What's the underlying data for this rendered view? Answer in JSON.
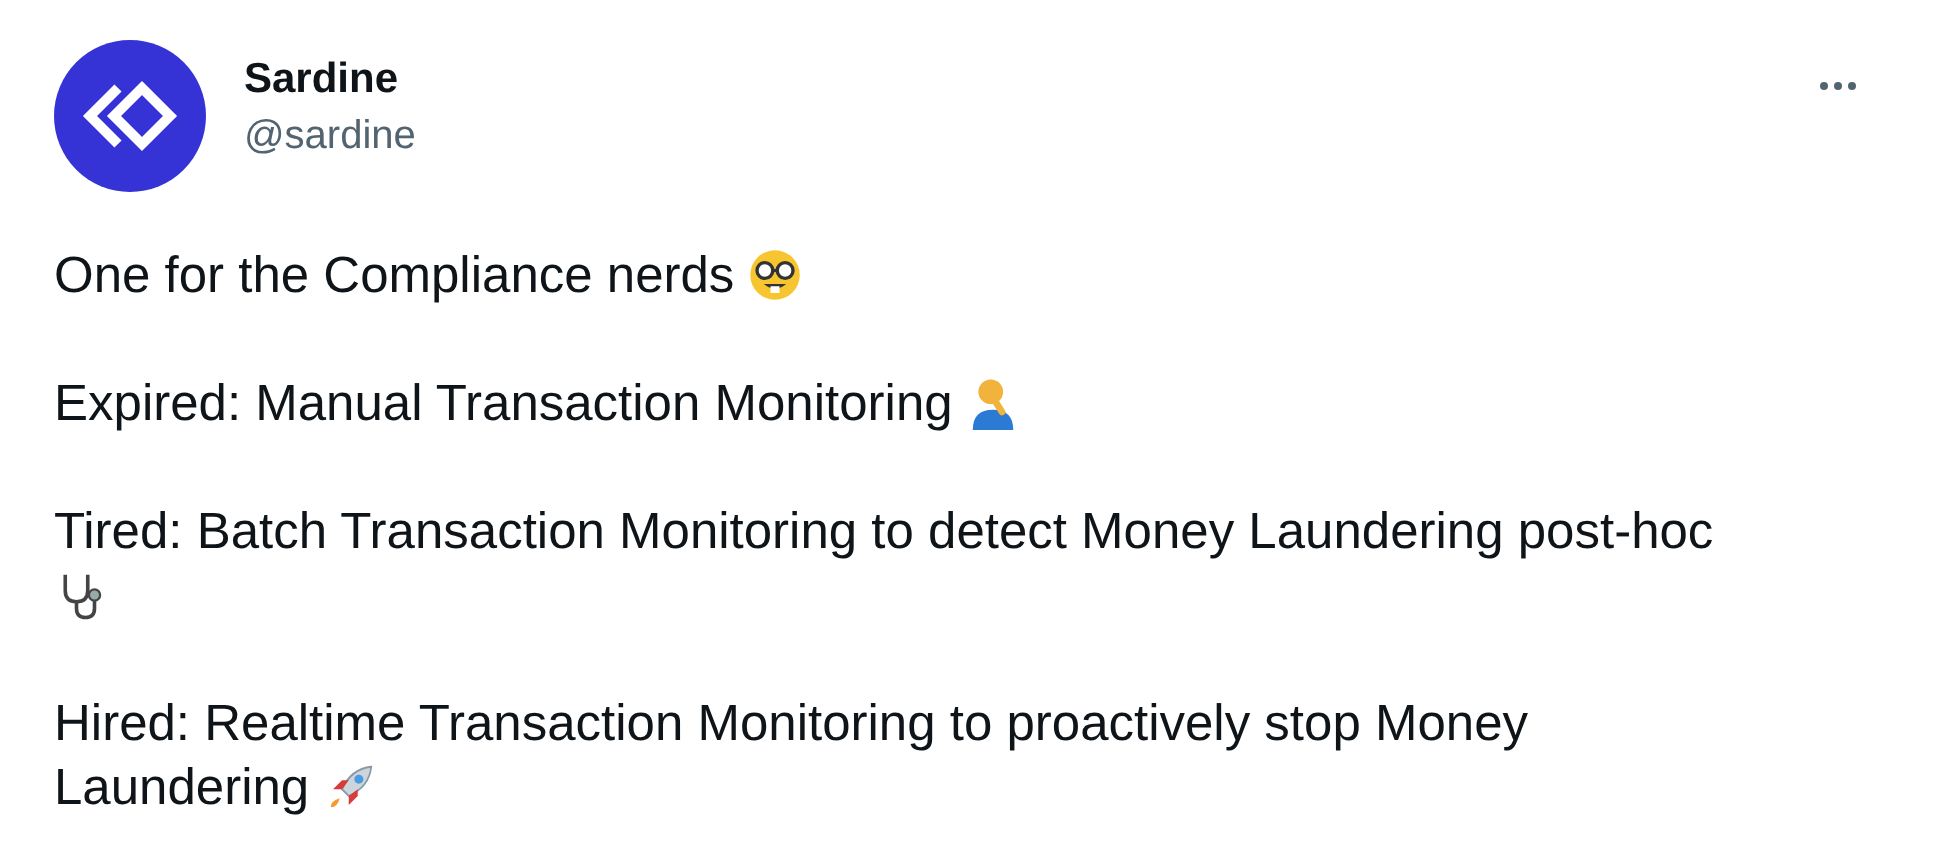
{
  "author": {
    "name": "Sardine",
    "handle": "@sardine"
  },
  "paragraphs": [
    {
      "text": "One for the Compliance nerds",
      "kind": "nerd"
    },
    {
      "text": "Expired: Manual Transaction Monitoring",
      "kind": "facepalm"
    },
    {
      "text": "Tired: Batch Transaction Monitoring to detect Money Laundering post-hoc",
      "kind": "stethoscope"
    },
    {
      "text": "Hired: Realtime Transaction Monitoring to proactively stop Money Laundering",
      "kind": "rocket"
    }
  ]
}
